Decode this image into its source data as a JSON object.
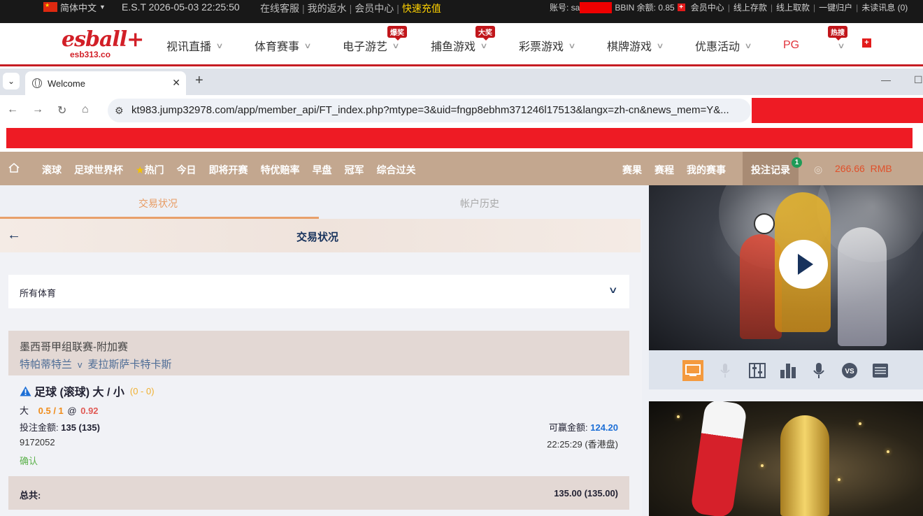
{
  "topbar": {
    "language": "简体中文",
    "est_time": "E.S.T 2026-05-03 22:25:50",
    "links": [
      "在线客服",
      "我的返水",
      "会员中心",
      "快速充值"
    ],
    "account_label": "账号: sa",
    "bbin_balance": "BBIN 余额: 0.85",
    "right_links": [
      "会员中心",
      "线上存款",
      "线上取款",
      "一键归户",
      "未读讯息 (0)"
    ]
  },
  "mainnav": {
    "logo_text": "esball+",
    "logo_domain": "esb313.co",
    "items": [
      {
        "label": "视讯直播",
        "badge": ""
      },
      {
        "label": "体育赛事",
        "badge": ""
      },
      {
        "label": "电子游艺",
        "badge": "爆奖"
      },
      {
        "label": "捕鱼游戏",
        "badge": "大奖"
      },
      {
        "label": "彩票游戏",
        "badge": ""
      },
      {
        "label": "棋牌游戏",
        "badge": ""
      },
      {
        "label": "优惠活动",
        "badge": ""
      },
      {
        "label": "PG",
        "badge": "热搜"
      }
    ]
  },
  "browser": {
    "tab_title": "Welcome",
    "url": "kt983.jump32978.com/app/member_api/FT_index.php?mtype=3&uid=fngp8ebhm371246l17513&langx=zh-cn&news_mem=Y&..."
  },
  "sitemenu": {
    "left": [
      "滚球",
      "足球世界杯",
      "热门",
      "今日",
      "即将开赛",
      "特优赔率",
      "早盘",
      "冠军",
      "综合过关"
    ],
    "right": [
      "赛果",
      "赛程",
      "我的赛事"
    ],
    "bet_record": "投注记录",
    "bet_record_count": "1",
    "balance": "266.66",
    "currency": "RMB"
  },
  "content": {
    "subtabs": [
      "交易状况",
      "帐户历史"
    ],
    "header_title": "交易状况",
    "sport_filter": "所有体育",
    "bet": {
      "league": "墨西哥甲组联赛-附加赛",
      "home": "特帕蒂特兰",
      "vs": "v",
      "away": "麦拉斯萨卡特卡斯",
      "bet_type": "足球 (滚球) 大 / 小",
      "score": "(0 - 0)",
      "selection": "大",
      "line": "0.5 / 1",
      "at": "@",
      "odds": "0.92",
      "stake_label": "投注金额:",
      "stake_value": "135 (135)",
      "win_label": "可赢金额:",
      "win_value": "124.20",
      "ticket_id": "9172052",
      "time": "22:25:29 (香港盘)",
      "status": "确认"
    },
    "total_label": "总共:",
    "total_value": "135.00 (135.00)"
  },
  "video_toolbar": [
    "tv-icon",
    "mic-icon",
    "stats-icon",
    "bar-chart-icon",
    "commentary-icon",
    "vs-icon",
    "scoreboard-icon"
  ]
}
